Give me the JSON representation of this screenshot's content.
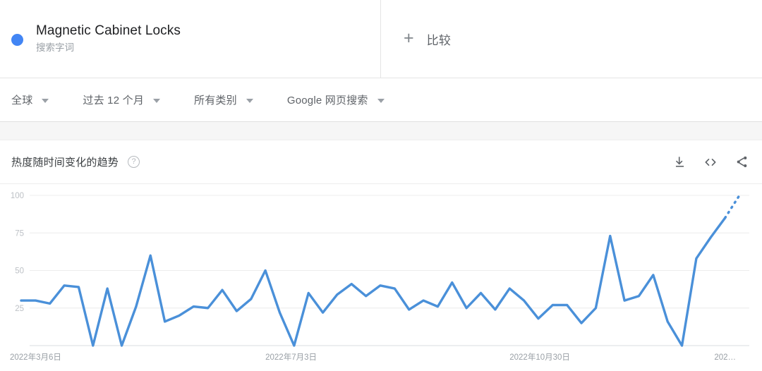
{
  "term": {
    "name": "Magnetic Cabinet Locks",
    "subtitle": "搜索字词",
    "dot_color": "#4285F4"
  },
  "compare": {
    "plus": "+",
    "label": "比较"
  },
  "filters": [
    {
      "label": "全球"
    },
    {
      "label": "过去 12 个月"
    },
    {
      "label": "所有类别"
    },
    {
      "label": "Google 网页搜索"
    }
  ],
  "chart_header": {
    "title": "热度随时间变化的趋势",
    "help_glyph": "?",
    "actions": [
      {
        "name": "download-icon"
      },
      {
        "name": "embed-icon"
      },
      {
        "name": "share-icon"
      }
    ]
  },
  "chart_data": {
    "type": "line",
    "title": "热度随时间变化的趋势",
    "xlabel": "",
    "ylabel": "",
    "ylim": [
      0,
      100
    ],
    "yticks": [
      25,
      50,
      75,
      100
    ],
    "grid": true,
    "legend": false,
    "line_color": "#4a90d9",
    "forecast_dashed": true,
    "xticks": [
      {
        "label": "2022年3月6日",
        "index": 0
      },
      {
        "label": "2022年7月3日",
        "index": 17
      },
      {
        "label": "2022年10月30日",
        "index": 34
      },
      {
        "label": "202…",
        "index": 51
      }
    ],
    "values": [
      30,
      30,
      28,
      40,
      39,
      0,
      38,
      0,
      26,
      60,
      16,
      20,
      26,
      25,
      37,
      23,
      31,
      50,
      22,
      0,
      35,
      22,
      34,
      41,
      33,
      40,
      38,
      24,
      30,
      26,
      42,
      25,
      35,
      24,
      38,
      30,
      18,
      27,
      27,
      15,
      25,
      73,
      30,
      33,
      47,
      16,
      0,
      58,
      72,
      85,
      100
    ],
    "notes": "Weekly Google Trends interest index, normalized 0-100. Final segment shown as dotted forecast."
  }
}
